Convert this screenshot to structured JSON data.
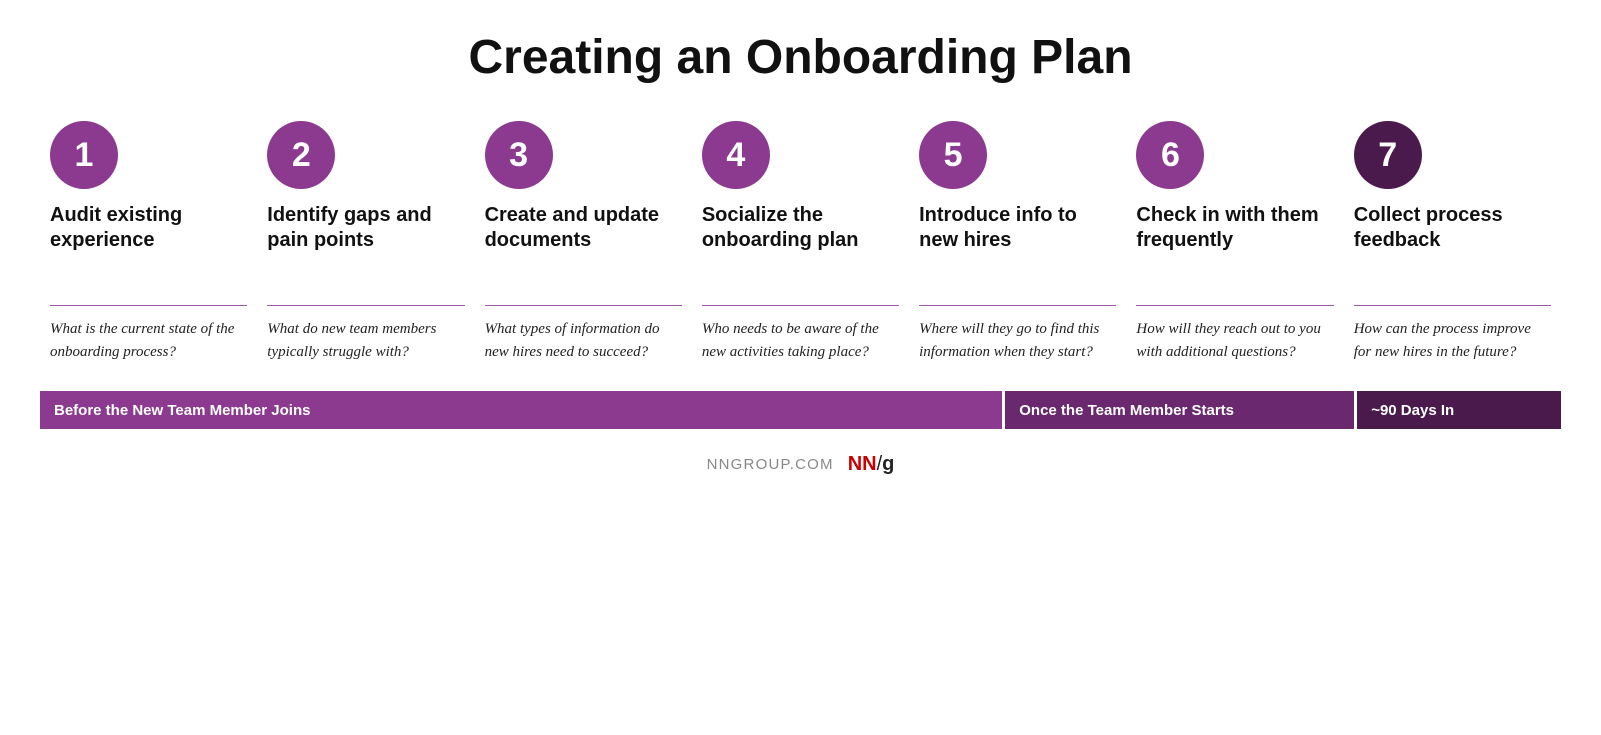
{
  "header": {
    "title": "Creating an Onboarding Plan"
  },
  "steps": [
    {
      "number": "1",
      "circle_class": "circle-light",
      "title": "Audit existing experience",
      "question": "What is the current state of the onboarding process?"
    },
    {
      "number": "2",
      "circle_class": "circle-light",
      "title": "Identify gaps and pain points",
      "question": "What do new team members typically struggle with?"
    },
    {
      "number": "3",
      "circle_class": "circle-light",
      "title": "Create and update documents",
      "question": "What types of information do new hires need to succeed?"
    },
    {
      "number": "4",
      "circle_class": "circle-light",
      "title": "Socialize the onboarding plan",
      "question": "Who needs to be aware of the new activities taking place?"
    },
    {
      "number": "5",
      "circle_class": "circle-light",
      "title": "Introduce info to new hires",
      "question": "Where will they go to find this information when they start?"
    },
    {
      "number": "6",
      "circle_class": "circle-light",
      "title": "Check in with them frequently",
      "question": "How will they reach out to you with additional questions?"
    },
    {
      "number": "7",
      "circle_class": "circle-dark",
      "title": "Collect process feedback",
      "question": "How can the process improve for new hires in the future?"
    }
  ],
  "timeline": {
    "before": "Before the New Team Member Joins",
    "starts": "Once the Team Member Starts",
    "days90": "~90 Days In"
  },
  "footer": {
    "url": "NNGROUP.COM",
    "logo_nn": "NN",
    "logo_slash": "/",
    "logo_g": "g"
  }
}
